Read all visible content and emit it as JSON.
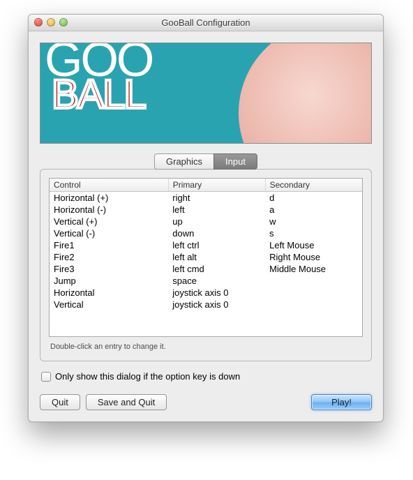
{
  "window": {
    "title": "GooBall Configuration"
  },
  "banner": {
    "line1": "GOO",
    "line2": "BALL"
  },
  "tabs": {
    "graphics": "Graphics",
    "input": "Input",
    "active": "input"
  },
  "table": {
    "headers": {
      "control": "Control",
      "primary": "Primary",
      "secondary": "Secondary"
    },
    "rows": [
      {
        "control": "Horizontal (+)",
        "primary": "right",
        "secondary": "d"
      },
      {
        "control": "Horizontal (-)",
        "primary": "left",
        "secondary": "a"
      },
      {
        "control": "Vertical (+)",
        "primary": "up",
        "secondary": "w"
      },
      {
        "control": "Vertical (-)",
        "primary": "down",
        "secondary": "s"
      },
      {
        "control": "Fire1",
        "primary": "left ctrl",
        "secondary": "Left Mouse"
      },
      {
        "control": "Fire2",
        "primary": "left alt",
        "secondary": "Right Mouse"
      },
      {
        "control": "Fire3",
        "primary": "left cmd",
        "secondary": "Middle Mouse"
      },
      {
        "control": "Jump",
        "primary": "space",
        "secondary": ""
      },
      {
        "control": "Horizontal",
        "primary": "joystick axis 0",
        "secondary": ""
      },
      {
        "control": "Vertical",
        "primary": "joystick axis 0",
        "secondary": ""
      }
    ]
  },
  "hint": "Double-click an entry to change it.",
  "checkbox": {
    "label": "Only show this dialog if the option key is down",
    "checked": false
  },
  "buttons": {
    "quit": "Quit",
    "save_quit": "Save and Quit",
    "play": "Play!"
  }
}
